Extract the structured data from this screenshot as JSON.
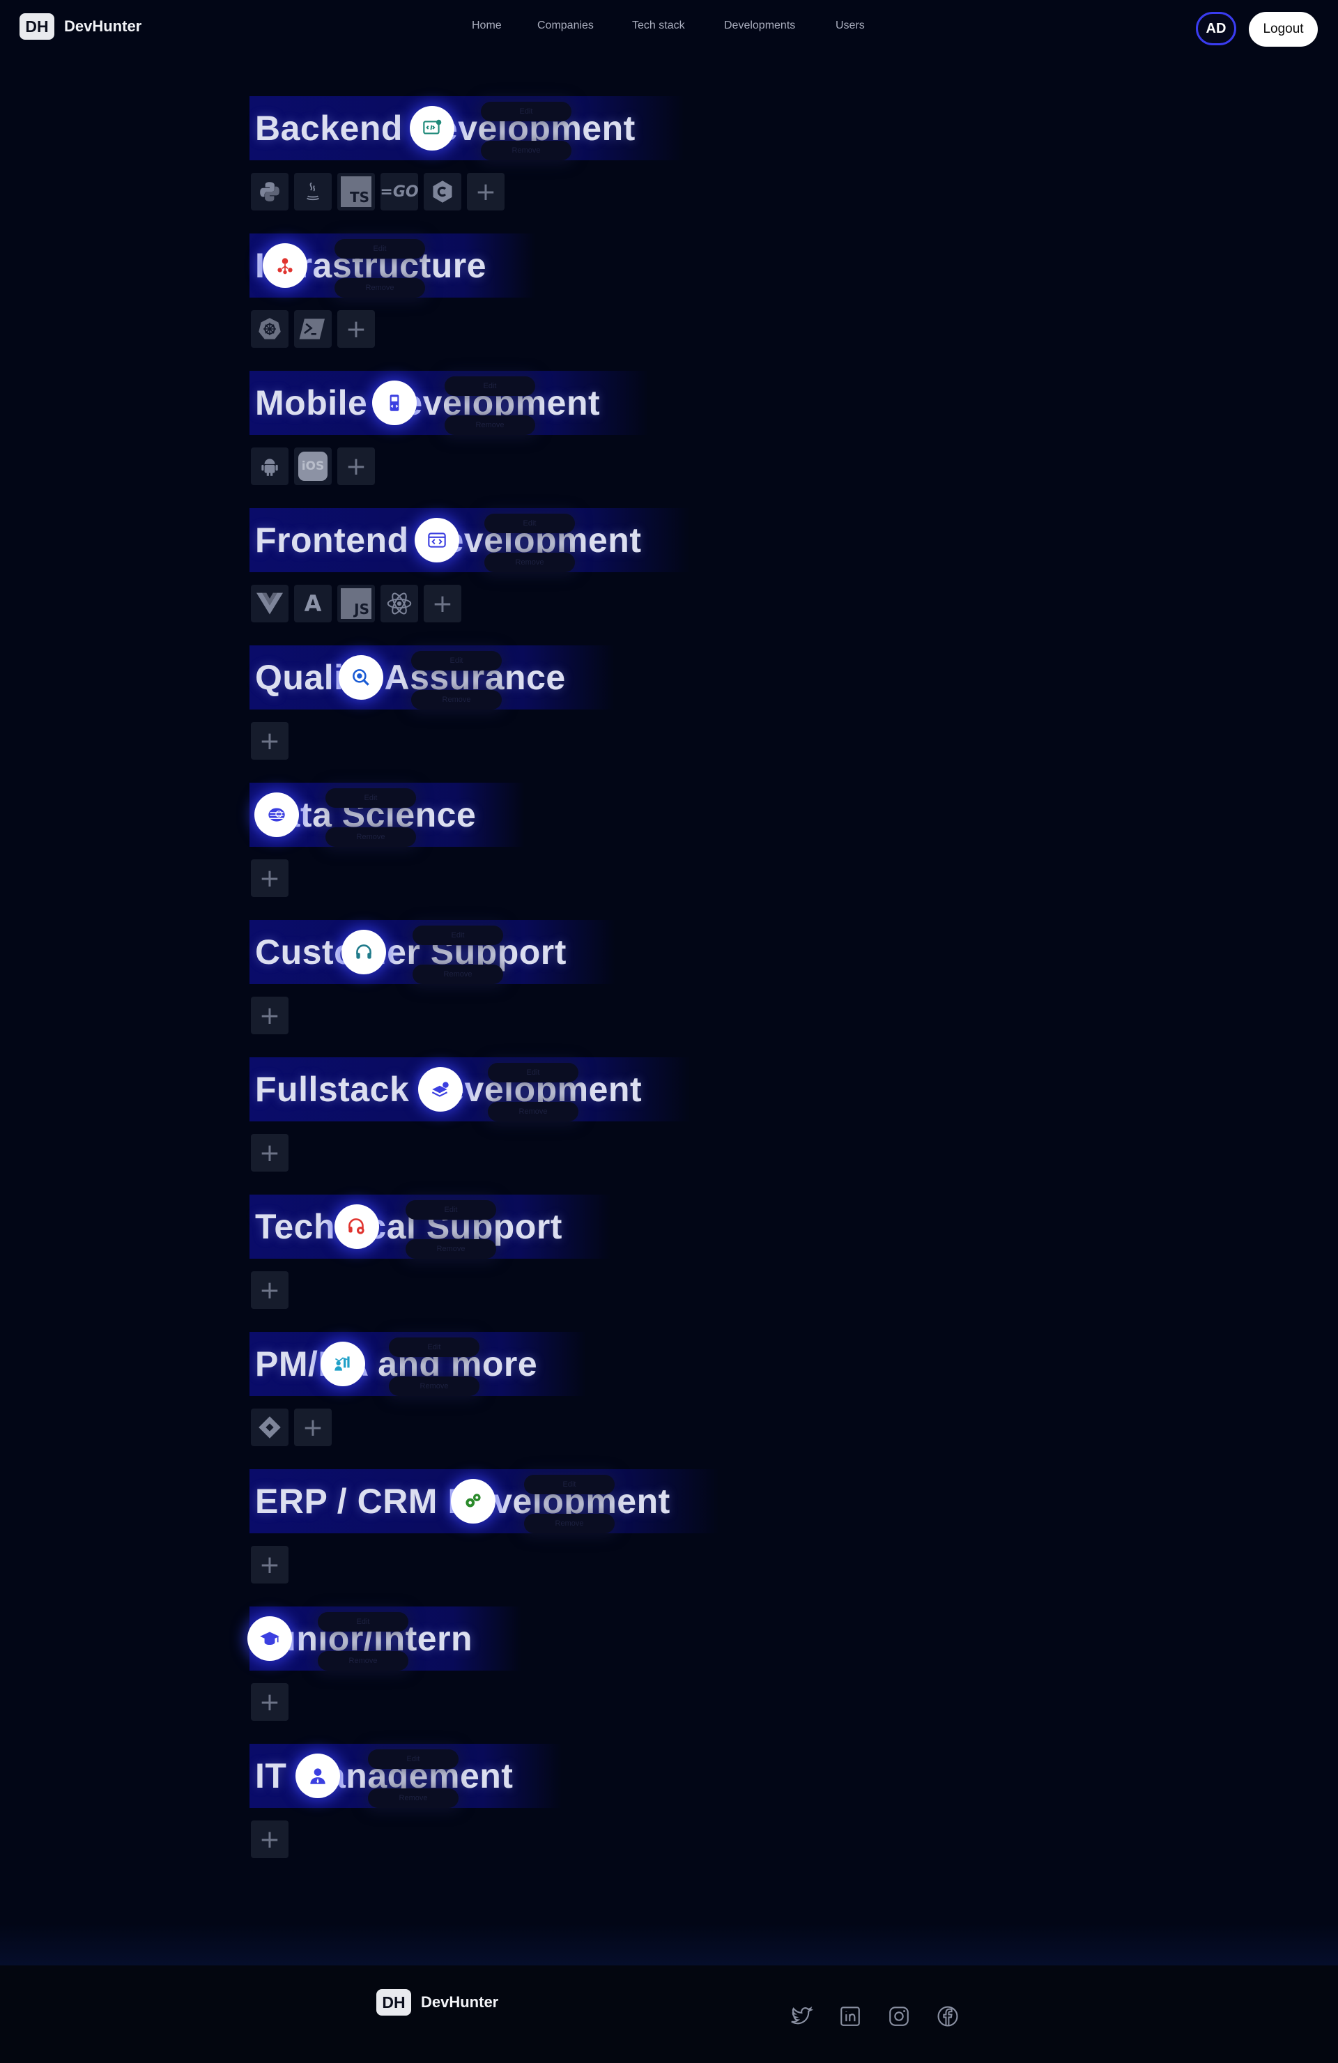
{
  "app": {
    "logo_mark": "DH",
    "name": "DevHunter"
  },
  "nav": {
    "items": [
      "Home",
      "Companies",
      "Tech stack",
      "Developments",
      "Users"
    ]
  },
  "user": {
    "initials": "AD",
    "logout_label": "Logout"
  },
  "actions": {
    "edit_label": "Edit",
    "remove_label": "Remove"
  },
  "developments": [
    {
      "title": "Backend Development",
      "icon": "code-gear-icon",
      "icon_color": "#1f8a7a",
      "tech": [
        "python-icon",
        "java-icon",
        "typescript-icon",
        "go-icon",
        "csharp-icon"
      ]
    },
    {
      "title": "Infrastructure",
      "icon": "network-gear-icon",
      "icon_color": "#e0342f",
      "tech": [
        "kubernetes-icon",
        "powershell-icon"
      ]
    },
    {
      "title": "Mobile Development",
      "icon": "mobile-code-icon",
      "icon_color": "#3b3fe0",
      "tech": [
        "android-icon",
        "ios-icon"
      ]
    },
    {
      "title": "Frontend Development",
      "icon": "browser-code-icon",
      "icon_color": "#3b3fe0",
      "tech": [
        "vue-icon",
        "angular-icon",
        "javascript-icon",
        "react-icon"
      ]
    },
    {
      "title": "Quality Assurance",
      "icon": "search-bug-icon",
      "icon_color": "#1a5bd4",
      "tech": []
    },
    {
      "title": "Data Science",
      "icon": "database-icon",
      "icon_color": "#3b3fe0",
      "tech": []
    },
    {
      "title": "Customer Support",
      "icon": "headset-icon",
      "icon_color": "#1f7a8a",
      "tech": []
    },
    {
      "title": "Fullstack Development",
      "icon": "layers-gear-icon",
      "icon_color": "#3b3fe0",
      "tech": []
    },
    {
      "title": "Technical Support",
      "icon": "headset-gear-icon",
      "icon_color": "#e0342f",
      "tech": []
    },
    {
      "title": "PM/BA and more",
      "icon": "analytics-team-icon",
      "icon_color": "#1fa0c8",
      "tech": [
        "jira-icon"
      ]
    },
    {
      "title": "ERP / CRM Development",
      "icon": "gears-icon",
      "icon_color": "#2b8a2b",
      "tech": []
    },
    {
      "title": "Junior/Intern",
      "icon": "graduation-cap-icon",
      "icon_color": "#3b3fe0",
      "tech": []
    },
    {
      "title": "IT Management",
      "icon": "manager-icon",
      "icon_color": "#3b3fe0",
      "tech": []
    }
  ],
  "footer": {
    "logo_mark": "DH",
    "name": "DevHunter",
    "social": [
      "twitter-icon",
      "linkedin-icon",
      "instagram-icon",
      "facebook-icon"
    ]
  }
}
